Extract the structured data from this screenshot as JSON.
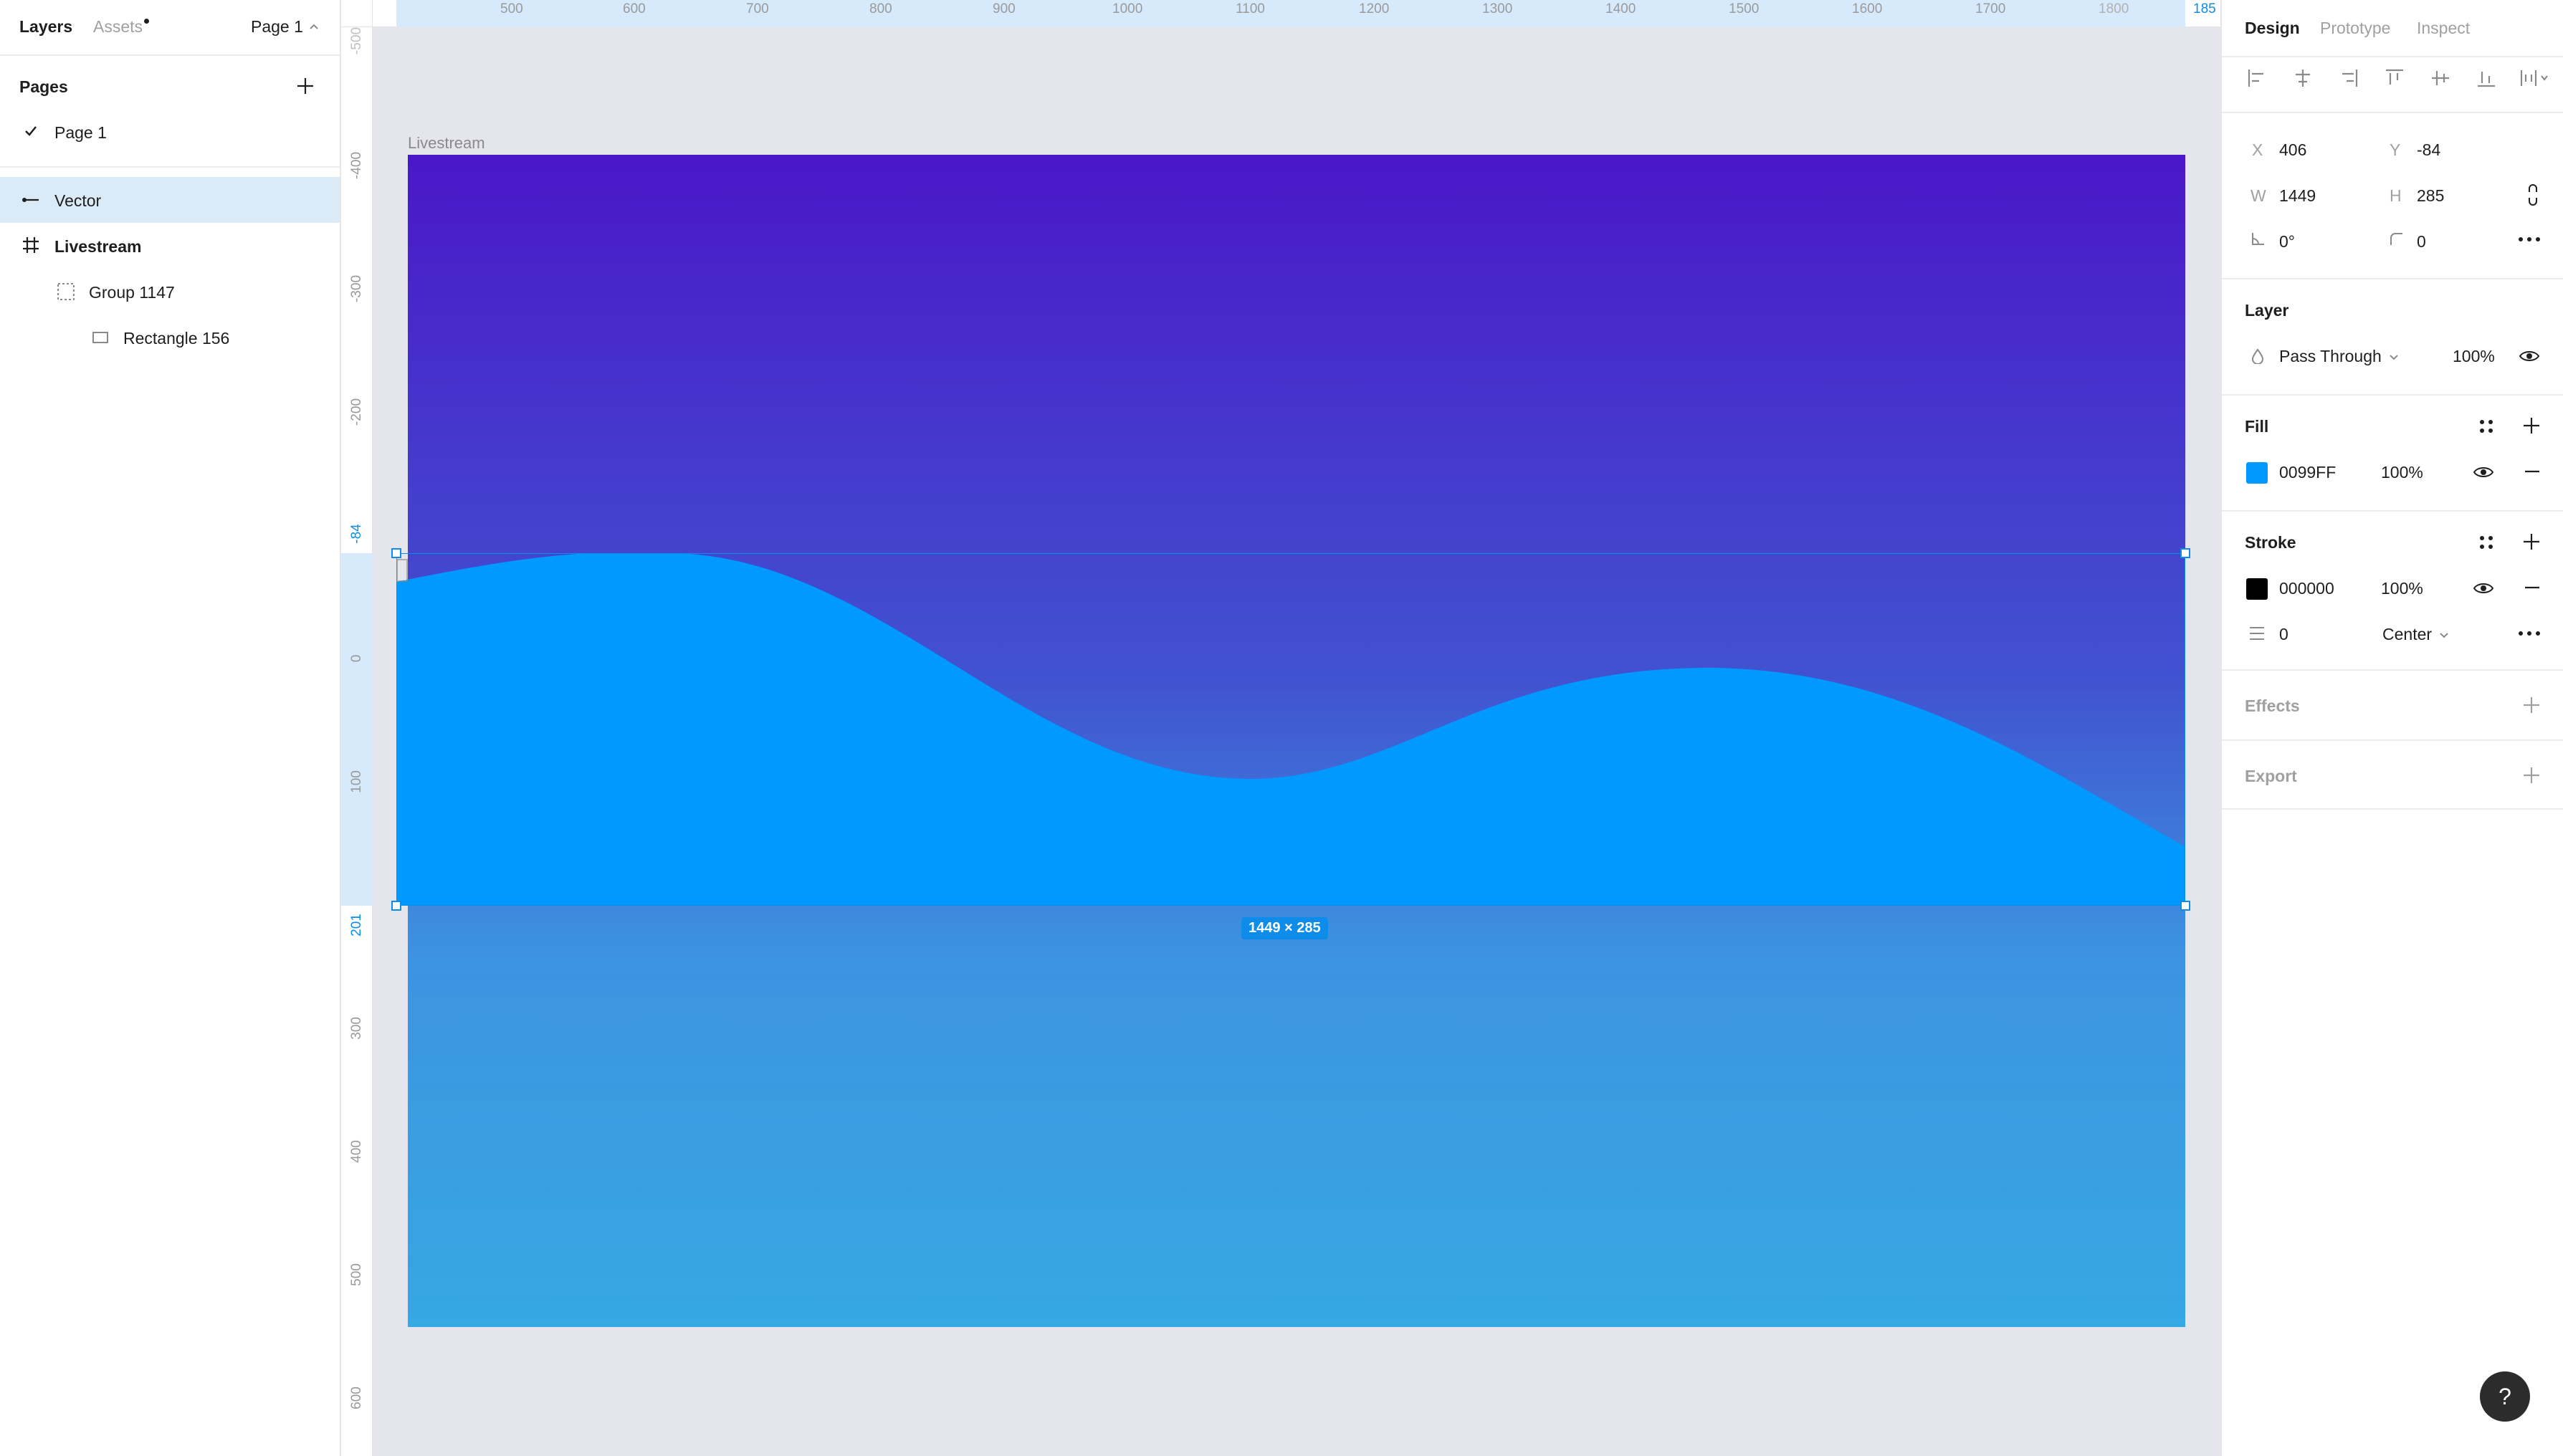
{
  "left_panel": {
    "tabs": {
      "layers": "Layers",
      "assets": "Assets",
      "page_switcher": "Page 1"
    },
    "pages": {
      "heading": "Pages",
      "items": [
        {
          "label": "Page 1"
        }
      ]
    },
    "layers": [
      {
        "name": "Vector",
        "icon": "vector-line-icon",
        "selected": true
      },
      {
        "name": "Livestream",
        "icon": "frame-hash-icon"
      },
      {
        "name": "Group 1147",
        "icon": "group-dashed-icon"
      },
      {
        "name": "Rectangle 156",
        "icon": "rectangle-icon"
      }
    ]
  },
  "canvas": {
    "frame_label": "Livestream",
    "size_badge": "1449 × 285",
    "ruler_top": [
      "500",
      "600",
      "700",
      "800",
      "900",
      "1000",
      "1100",
      "1200",
      "1300",
      "1400",
      "1500",
      "1600",
      "1700",
      "1800",
      "185"
    ],
    "ruler_left": [
      "-500",
      "-400",
      "-300",
      "-200",
      "-84",
      "0",
      "100",
      "201",
      "300",
      "400",
      "500",
      "600"
    ],
    "colors": {
      "fill": "#0099FF",
      "frame_top": "#4a17c8",
      "frame_bottom": "#36a8e3",
      "selection": "#0d8ce9"
    }
  },
  "right_panel": {
    "tabs": {
      "design": "Design",
      "prototype": "Prototype",
      "inspect": "Inspect"
    },
    "position": {
      "x_label": "X",
      "x": "406",
      "y_label": "Y",
      "y": "-84",
      "w_label": "W",
      "w": "1449",
      "h_label": "H",
      "h": "285",
      "rotation": "0°",
      "radius": "0"
    },
    "layer": {
      "heading": "Layer",
      "blend": "Pass Through",
      "opacity": "100%"
    },
    "fill": {
      "heading": "Fill",
      "hex": "0099FF",
      "opacity": "100%",
      "color": "#0099FF"
    },
    "stroke": {
      "heading": "Stroke",
      "hex": "000000",
      "opacity": "100%",
      "color": "#000000",
      "weight": "0",
      "align": "Center"
    },
    "effects": {
      "heading": "Effects"
    },
    "export": {
      "heading": "Export"
    }
  },
  "help": {
    "label": "?"
  }
}
